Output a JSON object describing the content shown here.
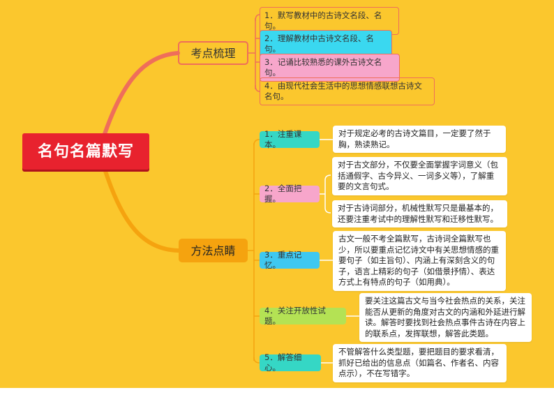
{
  "root": {
    "label": "名句名篇默写"
  },
  "branches": [
    {
      "label": "考点梳理",
      "items": [
        "1．默写教材中的古诗文名段、名句。",
        "2．理解教材中古诗文名段、名句。",
        "3．记诵比较熟悉的课外古诗文名句。",
        "4．由现代社会生活中的思想情感联想古诗文名句。"
      ]
    },
    {
      "label": "方法点睛",
      "methods": [
        {
          "label": "1．注重课本。",
          "details": [
            "对于规定必考的古诗文篇目，一定要了然于胸，熟读熟记。"
          ]
        },
        {
          "label": "2．全面把握。",
          "details": [
            "对于古文部分，不仅要全面掌握字词意义（包括通假字、古今异义、一词多义等），了解重要的文言句式。",
            "对于古诗词部分，机械性默写只是最基本的，还要注重考试中的理解性默写和迁移性默写。"
          ]
        },
        {
          "label": "3．重点记忆。",
          "details": [
            "古文一般不考全篇默写，古诗词全篇默写也少，所以要重点记忆诗文中有关思想情感的重要句子（如主旨句）、内涵上有深刻含义的句子，语言上精彩的句子（如借景抒情）、表达方式上有特点的句子（如用典）。"
          ]
        },
        {
          "label": "4．关注开放性试题。",
          "details": [
            "要关注这篇古文与当今社会热点的关系，关注能否从更新的角度对古文的内涵和外延进行解读。解答时要找到社会热点事件古诗在内容上的联系点，发挥联想，解答此类题。"
          ]
        },
        {
          "label": "5．解答细心。",
          "details": [
            "不管解答什么类型题，要把题目的要求看清，抓好已给出的信息点（如篇名、作者名、内容点示），不在写错字。"
          ]
        }
      ]
    }
  ],
  "colors": {
    "background": "#fbc72d",
    "root": "#e8222e",
    "branch_top_line": "#ef6e5a",
    "branch_bottom_fill": "#f5a30f",
    "teal": "#35d7c5",
    "pink": "#f7a6cb",
    "blue": "#3fc8f0",
    "lime": "#b4e254"
  }
}
